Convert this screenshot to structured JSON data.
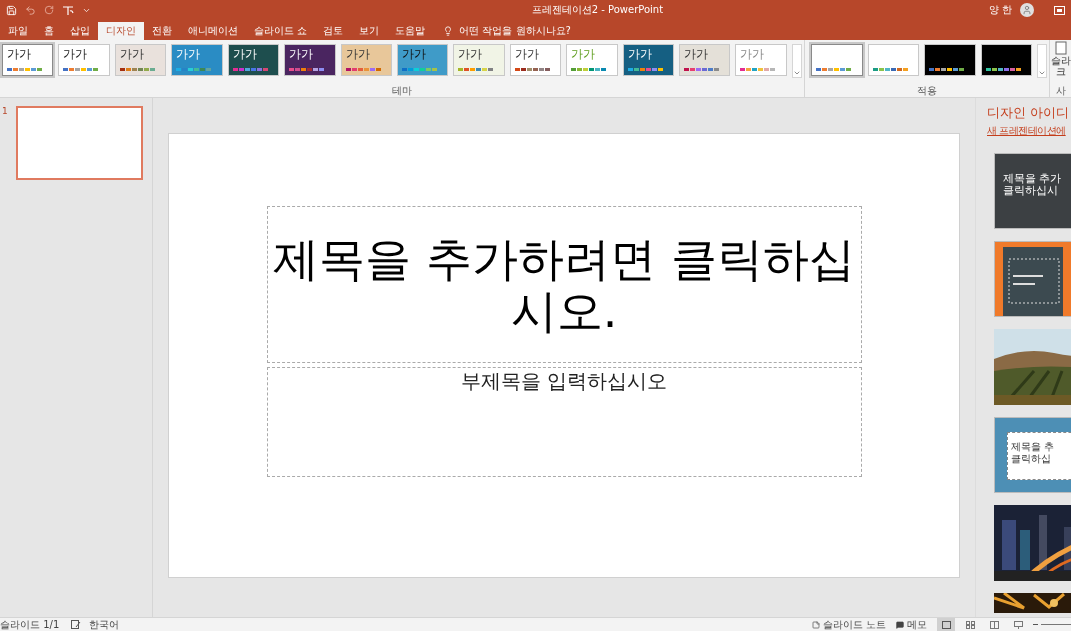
{
  "window": {
    "title": "프레젠테이션2 - PowerPoint",
    "user": "양 한"
  },
  "tabs": [
    {
      "label": "파일",
      "selected": false
    },
    {
      "label": "홈",
      "selected": false
    },
    {
      "label": "삽입",
      "selected": false
    },
    {
      "label": "디자인",
      "selected": true
    },
    {
      "label": "전환",
      "selected": false
    },
    {
      "label": "애니메이션",
      "selected": false
    },
    {
      "label": "슬라이드 쇼",
      "selected": false
    },
    {
      "label": "검토",
      "selected": false
    },
    {
      "label": "보기",
      "selected": false
    },
    {
      "label": "도움말",
      "selected": false
    }
  ],
  "tell_me": {
    "placeholder": "어떤 작업을 원하시나요?"
  },
  "themes": {
    "label": "테마",
    "items": [
      {
        "text": "가가",
        "selected": true
      },
      {
        "text": "가가",
        "selected": false
      },
      {
        "text": "가가",
        "selected": false
      },
      {
        "text": "가가",
        "selected": false
      },
      {
        "text": "가가",
        "selected": false
      },
      {
        "text": "가가",
        "selected": false
      },
      {
        "text": "가가",
        "selected": false
      },
      {
        "text": "가가",
        "selected": false
      },
      {
        "text": "가가",
        "selected": false
      },
      {
        "text": "가가",
        "selected": false
      },
      {
        "text": "가가",
        "selected": false
      },
      {
        "text": "가가",
        "selected": false
      },
      {
        "text": "가가",
        "selected": false
      },
      {
        "text": "가가",
        "selected": false
      }
    ]
  },
  "variants": {
    "label": "적용",
    "items": [
      {
        "selected": true
      },
      {
        "selected": false
      },
      {
        "selected": false
      },
      {
        "selected": false
      }
    ]
  },
  "slide_size": {
    "line_1": "슬라",
    "line_2": "크",
    "group": "사"
  },
  "slides": [
    {
      "number": "1",
      "selected": true
    }
  ],
  "slide": {
    "title": "제목을 추가하려면 클릭하십시오.",
    "subtitle": "부제목을 입력하십시오"
  },
  "design_ideas": {
    "title": "디자인 아이디",
    "subtitle": "새 프레젠테이션에",
    "items": [
      {
        "kind": "title-card",
        "line_1": "제목을 추가",
        "line_2": "클릭하십시"
      },
      {
        "kind": "framed"
      },
      {
        "kind": "picture"
      },
      {
        "kind": "boxed",
        "line_1": "제목을 추",
        "line_2": "클릭하십"
      },
      {
        "kind": "picture"
      },
      {
        "kind": "picture"
      }
    ]
  },
  "status_bar": {
    "slide_count": "슬라이드 1/1",
    "language": "한국어",
    "notes": "슬라이드 노트",
    "comments": "메모"
  }
}
